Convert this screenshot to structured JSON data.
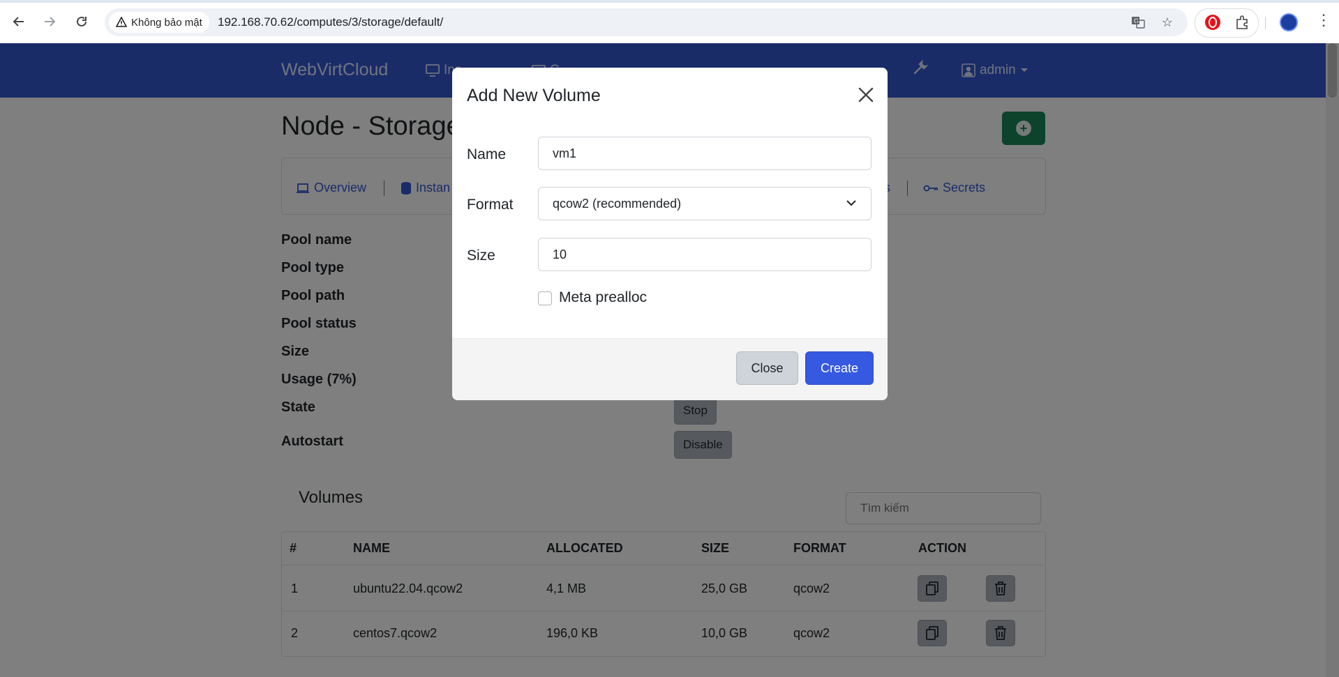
{
  "browser": {
    "security_label": "Không bảo mật",
    "url": "192.168.70.62/computes/3/storage/default/",
    "icons": [
      "back-icon",
      "forward-icon",
      "reload-icon",
      "warning-icon",
      "translate-icon",
      "star-icon",
      "opera-icon",
      "extensions-icon",
      "profile-icon",
      "menu-icon"
    ]
  },
  "navbar": {
    "brand": "WebVirtCloud",
    "links": [
      "Ins",
      "C"
    ],
    "user": "admin"
  },
  "page": {
    "title": "Node - Storage",
    "tabs": [
      "Overview",
      "Instan",
      "s",
      "Secrets"
    ]
  },
  "properties": {
    "labels": [
      "Pool name",
      "Pool type",
      "Pool path",
      "Pool status",
      "Size",
      "Usage (7%)",
      "State",
      "Autostart"
    ],
    "state_button": "Stop",
    "autostart_button": "Disable"
  },
  "volumes": {
    "title": "Volumes",
    "search_placeholder": "Tìm kiếm",
    "columns": [
      "#",
      "NAME",
      "ALLOCATED",
      "SIZE",
      "FORMAT",
      "ACTION"
    ],
    "rows": [
      {
        "num": "1",
        "name": "ubuntu22.04.qcow2",
        "allocated": "4,1 MB",
        "size": "25,0 GB",
        "format": "qcow2"
      },
      {
        "num": "2",
        "name": "centos7.qcow2",
        "allocated": "196,0 KB",
        "size": "10,0 GB",
        "format": "qcow2"
      }
    ]
  },
  "modal": {
    "title": "Add New Volume",
    "name_label": "Name",
    "name_value": "vm1",
    "format_label": "Format",
    "format_value": "qcow2 (recommended)",
    "size_label": "Size",
    "size_value": "10",
    "prealloc_label": "Meta prealloc",
    "close_button": "Close",
    "create_button": "Create"
  },
  "colors": {
    "navbar": "#3559d0",
    "primary": "#3559e0",
    "success": "#198754",
    "secondary": "#adb5bd"
  }
}
